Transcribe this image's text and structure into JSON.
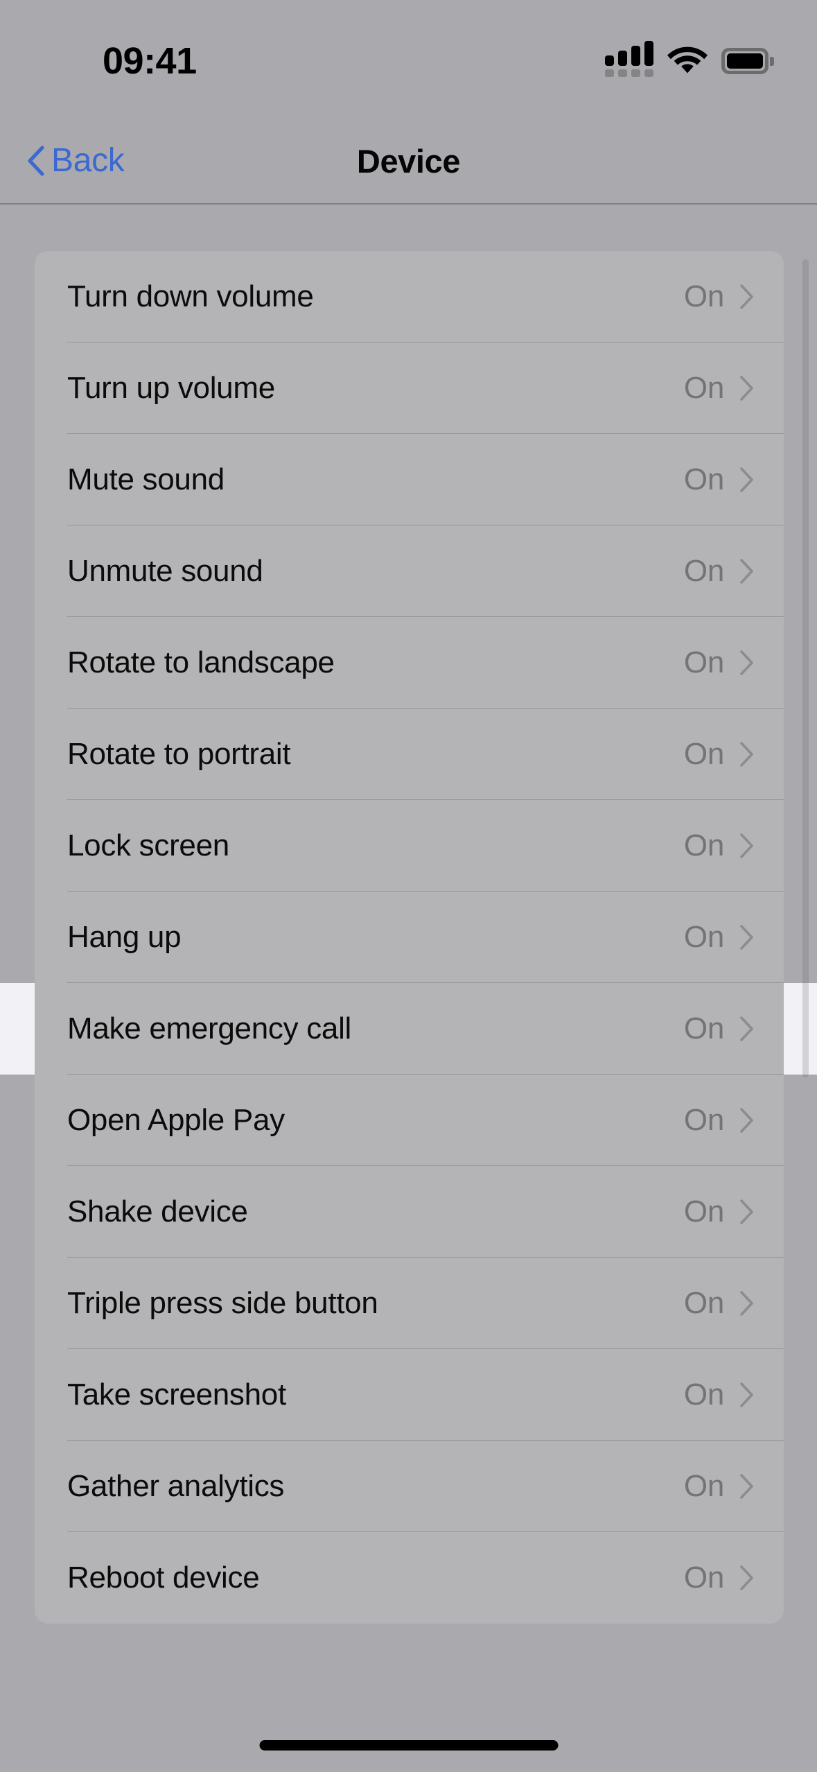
{
  "status_bar": {
    "time": "09:41",
    "signal_icon": "cellular-signal-icon",
    "signal_bars_filled": 4,
    "signal_bars_total": 4,
    "wifi_icon": "wifi-icon",
    "wifi_strength": "full",
    "battery_icon": "battery-icon",
    "battery_level": "full"
  },
  "nav_bar": {
    "back_label": "Back",
    "back_icon": "chevron-left-icon",
    "title": "Device",
    "back_color": "#3b68d1",
    "title_color": "#050505"
  },
  "colors": {
    "page_background": "#aaaaae",
    "card_background": "#b4b4b6",
    "highlight_band": "#f2f1f5",
    "highlight_row": "#ffffff",
    "row_label": "#0b0b0b",
    "row_value": "#747477",
    "separator": "rgba(60,60,67,0.26)",
    "accent_blue": "#3b68d1"
  },
  "list": {
    "value_on": "On",
    "chevron_icon": "chevron-right-icon",
    "highlighted_index": 8,
    "rows": [
      {
        "label": "Turn down volume",
        "value": "On"
      },
      {
        "label": "Turn up volume",
        "value": "On"
      },
      {
        "label": "Mute sound",
        "value": "On"
      },
      {
        "label": "Unmute sound",
        "value": "On"
      },
      {
        "label": "Rotate to landscape",
        "value": "On"
      },
      {
        "label": "Rotate to portrait",
        "value": "On"
      },
      {
        "label": "Lock screen",
        "value": "On"
      },
      {
        "label": "Hang up",
        "value": "On"
      },
      {
        "label": "Make emergency call",
        "value": "On"
      },
      {
        "label": "Open Apple Pay",
        "value": "On"
      },
      {
        "label": "Shake device",
        "value": "On"
      },
      {
        "label": "Triple press side button",
        "value": "On"
      },
      {
        "label": "Take screenshot",
        "value": "On"
      },
      {
        "label": "Gather analytics",
        "value": "On"
      },
      {
        "label": "Reboot device",
        "value": "On"
      }
    ]
  },
  "home_indicator": {
    "name": "home-indicator"
  }
}
